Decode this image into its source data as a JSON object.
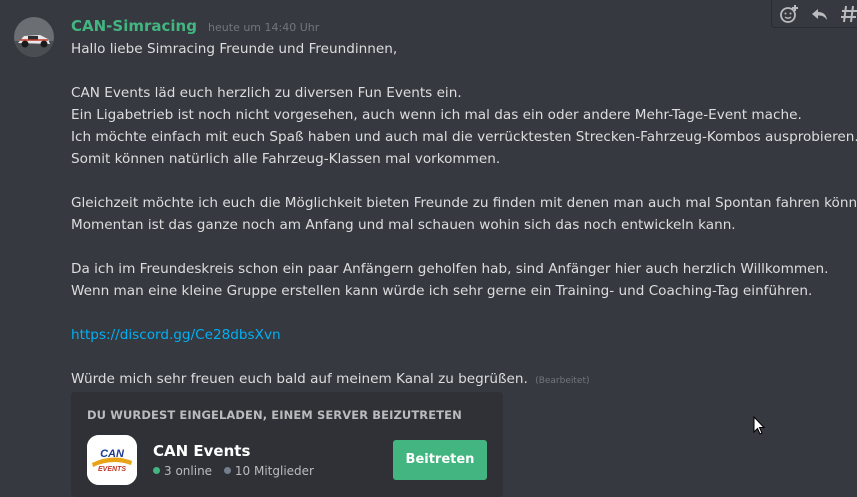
{
  "message": {
    "author": "CAN-Simracing",
    "timestamp": "heute um 14:40 Uhr",
    "lines": [
      "Hallo liebe Simracing Freunde und Freundinnen,",
      "",
      "CAN Events läd euch herzlich zu diversen Fun Events ein.",
      "Ein Ligabetrieb ist noch nicht vorgesehen, auch wenn ich mal das ein oder andere Mehr-Tage-Event mache.",
      "Ich möchte einfach mit euch Spaß haben und auch mal die verrücktesten Strecken-Fahrzeug-Kombos ausprobieren.",
      "Somit können natürlich alle Fahrzeug-Klassen mal vorkommen.",
      "",
      "Gleichzeit möchte ich euch die Möglichkeit bieten Freunde zu finden mit denen man auch mal Spontan fahren könnt.",
      "Momentan ist das ganze noch am Anfang und mal schauen wohin sich das noch entwickeln kann.",
      "",
      "Da ich im Freundeskreis schon ein paar Anfängern geholfen hab, sind Anfänger hier auch herzlich Willkommen.",
      "Wenn man eine kleine Gruppe erstellen kann würde ich sehr gerne ein Training- und Coaching-Tag einführen.",
      ""
    ],
    "link": "https://discord.gg/Ce28dbsXvn",
    "closing": "Würde mich sehr freuen euch bald auf meinem Kanal zu begrüßen.",
    "edited_label": "(Bearbeitet)"
  },
  "toolbar": {
    "icons": [
      "add-reaction-icon",
      "reply-icon",
      "more-icon"
    ]
  },
  "invite": {
    "header": "DU WURDEST EINGELADEN, EINEM SERVER BEIZUTRETEN",
    "server_name": "CAN Events",
    "online_count": "3 online",
    "member_count": "10 Mitglieder",
    "join_label": "Beitreten",
    "logo_text": "CAN",
    "logo_subtext": "EVENTS"
  },
  "colors": {
    "background": "#36393f",
    "username": "#43b581",
    "link": "#00b0f4",
    "online_dot": "#43b581",
    "members_dot": "#747f8d",
    "join_button": "#43b581"
  }
}
